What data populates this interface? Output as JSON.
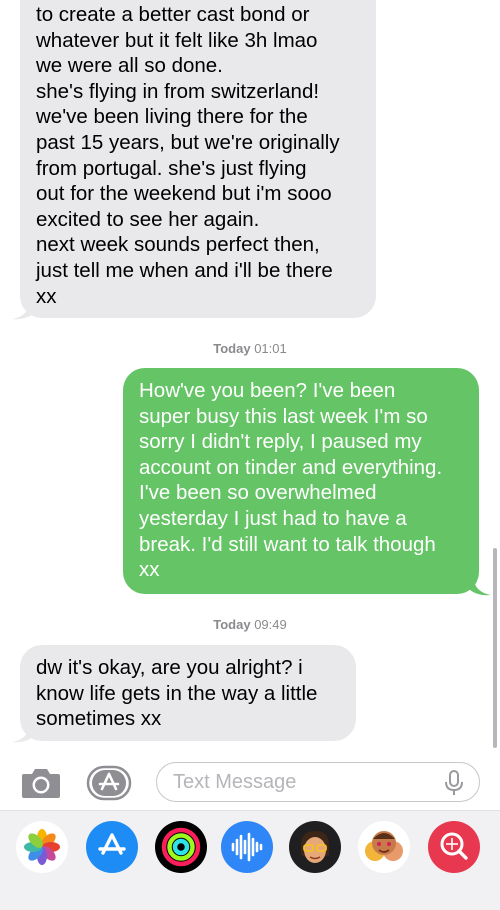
{
  "conversation": {
    "messages": [
      {
        "direction": "incoming",
        "text": "to create a better cast bond or\nwhatever but it felt like 3h lmao\nwe were all so done.\nshe's flying in from switzerland!\nwe've been living there for the\npast 15 years, but we're originally\nfrom portugal. she's just flying\nout for the weekend but i'm sooo\nexcited to see her again.\nnext week sounds perfect then,\njust tell me when and i'll be there\nxx"
      },
      {
        "direction": "outgoing",
        "text": "How've you been? I've been\nsuper busy this last week I'm so\nsorry I didn't reply, I paused my\naccount on tinder and everything.\nI've been so overwhelmed\nyesterday I just had to have a\nbreak. I'd still want to talk though\nxx"
      },
      {
        "direction": "incoming",
        "text": "dw it's okay, are you alright? i\nknow life gets in the way a little\nsometimes xx"
      }
    ],
    "timestamps": [
      {
        "day": "Today",
        "time": "01:01"
      },
      {
        "day": "Today",
        "time": "09:49"
      }
    ]
  },
  "compose": {
    "placeholder": "Text Message",
    "camera_icon": "camera-icon",
    "apps_icon": "app-store-icon",
    "mic_icon": "microphone-icon"
  },
  "app_drawer": {
    "apps": [
      {
        "icon": "photos-icon"
      },
      {
        "icon": "app-store-icon"
      },
      {
        "icon": "activity-icon"
      },
      {
        "icon": "audio-message-icon"
      },
      {
        "icon": "memoji-icon"
      },
      {
        "icon": "memoji-stickers-icon"
      },
      {
        "icon": "images-search-icon"
      }
    ]
  },
  "colors": {
    "incoming_bubble": "#e9e9eb",
    "outgoing_bubble": "#65c466",
    "timestamp": "#8a8a8e"
  }
}
